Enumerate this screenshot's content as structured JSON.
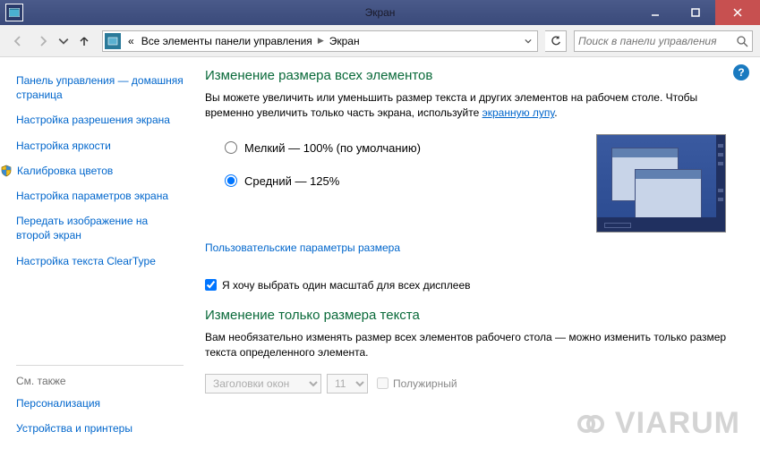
{
  "window": {
    "title": "Экран"
  },
  "nav": {
    "breadcrumb_prefix": "«",
    "crumb1": "Все элементы панели управления",
    "crumb2": "Экран",
    "search_placeholder": "Поиск в панели управления"
  },
  "sidebar": {
    "items": [
      "Панель управления — домашняя страница",
      "Настройка разрешения экрана",
      "Настройка яркости",
      "Калибровка цветов",
      "Настройка параметров экрана",
      "Передать изображение на второй экран",
      "Настройка текста ClearType"
    ],
    "see_also_label": "См. также",
    "see_also": [
      "Персонализация",
      "Устройства и принтеры"
    ]
  },
  "main": {
    "heading1": "Изменение размера всех элементов",
    "desc1_a": "Вы можете увеличить или уменьшить размер текста и других элементов на рабочем столе. Чтобы временно увеличить только часть экрана, используйте ",
    "desc1_link": "экранную лупу",
    "desc1_b": ".",
    "radios": [
      {
        "label": "Мелкий — 100% (по умолчанию)",
        "checked": false
      },
      {
        "label": "Средний — 125%",
        "checked": true
      }
    ],
    "custom_link": "Пользовательские параметры размера",
    "checkbox_label": "Я хочу выбрать один масштаб для всех дисплеев",
    "heading2": "Изменение только размера текста",
    "desc2": "Вам необязательно изменять размер всех элементов рабочего стола — можно изменить только размер текста определенного элемента.",
    "element_select": "Заголовки окон",
    "size_select": "11",
    "bold_label": "Полужирный"
  },
  "watermark": "VIARUM"
}
